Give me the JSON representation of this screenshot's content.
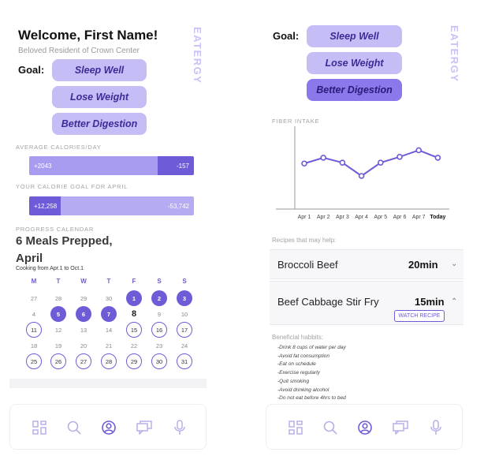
{
  "brand": "EATERGY",
  "left": {
    "welcome": "Welcome, First Name!",
    "subtitle": "Beloved Resident of Crown Center",
    "goal_label": "Goal:",
    "goals": [
      "Sleep Well",
      "Lose Weight",
      "Better Digestion"
    ],
    "avg_cal_label": "AVERAGE CALORIES/DAY",
    "avg_cal_pos": "+2043",
    "avg_cal_neg": "-157",
    "avg_cal_fraction": 0.78,
    "goal_april_label": "YOUR CALORIE GOAL FOR APRIL",
    "goal_april_pos": "+12,258",
    "goal_april_neg": "-53,742",
    "goal_april_fraction": 0.19,
    "progress_label": "PROGRESS CALENDAR",
    "meals_title_1": "6 Meals Prepped,",
    "meals_title_2": "April",
    "cooking_range": "Cooking from Apr.1 to Oct.1",
    "weekdays": [
      "M",
      "T",
      "W",
      "T",
      "F",
      "S",
      "S"
    ],
    "calendar_rows": [
      [
        [
          "27",
          "plain"
        ],
        [
          "28",
          "plain"
        ],
        [
          "29",
          "plain"
        ],
        [
          "30",
          "plain"
        ],
        [
          "1",
          "filled"
        ],
        [
          "2",
          "filled"
        ],
        [
          "3",
          "filled"
        ]
      ],
      [
        [
          "4",
          "plain"
        ],
        [
          "5",
          "filled"
        ],
        [
          "6",
          "filled"
        ],
        [
          "7",
          "filled"
        ],
        [
          "8",
          "today"
        ],
        [
          "9",
          "plain"
        ],
        [
          "10",
          "plain"
        ]
      ],
      [
        [
          "11",
          "outlined"
        ],
        [
          "12",
          "plain"
        ],
        [
          "13",
          "plain"
        ],
        [
          "14",
          "plain"
        ],
        [
          "15",
          "outlined"
        ],
        [
          "16",
          "outlined"
        ],
        [
          "17",
          "outlined"
        ]
      ],
      [
        [
          "18",
          "plain"
        ],
        [
          "19",
          "plain"
        ],
        [
          "20",
          "plain"
        ],
        [
          "21",
          "plain"
        ],
        [
          "22",
          "plain"
        ],
        [
          "23",
          "plain"
        ],
        [
          "24",
          "plain"
        ]
      ],
      [
        [
          "25",
          "outlined"
        ],
        [
          "26",
          "outlined"
        ],
        [
          "27",
          "outlined"
        ],
        [
          "28",
          "outlined"
        ],
        [
          "29",
          "outlined"
        ],
        [
          "30",
          "outlined"
        ],
        [
          "31",
          "outlined"
        ]
      ]
    ]
  },
  "right": {
    "goal_label": "Goal:",
    "goals": [
      "Sleep Well",
      "Lose Weight",
      "Better Digestion"
    ],
    "active_goal": "Better Digestion",
    "chart_label": "FIBER INTAKE",
    "recipes_label": "Recipes that may help:",
    "recipes": [
      {
        "name": "Broccoli Beef",
        "time": "20min",
        "chevron": "⌄"
      },
      {
        "name": "Beef Cabbage Stir Fry",
        "time": "15min",
        "chevron": "⌃"
      }
    ],
    "watch_label": "WATCH RECIPE",
    "habits_title": "Beneficial habbits:",
    "habits": [
      "-Drink 8 cups of water per day",
      "-Avoid fat consumption",
      "-Eat on schedule",
      "-Exercise regularly",
      "-Quit smoking",
      "-Avoid drinking alcohol",
      "-Do not eat before 4hrs to bed"
    ]
  },
  "nav": [
    "grid-icon",
    "search-icon",
    "profile-icon",
    "chat-icon",
    "mic-icon"
  ],
  "colors": {
    "accent": "#6d5bd8",
    "light_accent": "#c4bdf6",
    "brand_text": "#c9c2f5"
  },
  "chart_data": {
    "type": "line",
    "categories": [
      "Apr 1",
      "Apr 2",
      "Apr 3",
      "Apr 4",
      "Apr 5",
      "Apr 6",
      "Apr 7",
      "Today"
    ],
    "values": [
      55,
      62,
      56,
      40,
      56,
      63,
      71,
      62
    ],
    "ylim": [
      0,
      100
    ],
    "title": "FIBER INTAKE",
    "grid": false
  }
}
